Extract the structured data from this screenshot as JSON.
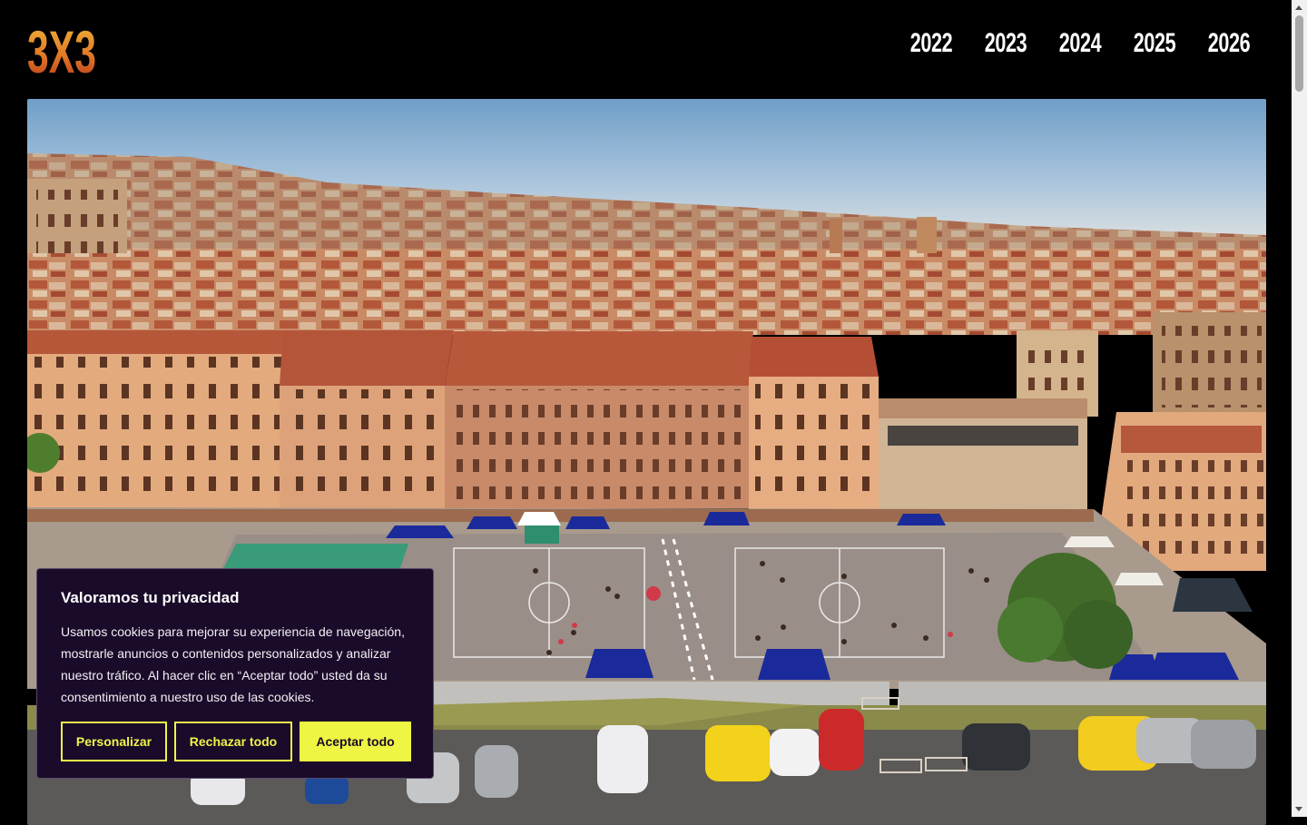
{
  "header": {
    "logo": {
      "text": "3X3",
      "icon": "3x3-logo"
    },
    "years": [
      "2022",
      "2023",
      "2024",
      "2025",
      "2026"
    ]
  },
  "hero": {
    "icon": "aerial-town-basketball-photo"
  },
  "cookie_banner": {
    "title": "Valoramos tu privacidad",
    "text": "Usamos cookies para mejorar su experiencia de navegación, mostrarle anuncios o contenidos personalizados y analizar nuestro tráfico. Al hacer clic en “Aceptar todo” usted da su consentimiento a nuestro uso de las cookies.",
    "customize_label": "Personalizar",
    "reject_label": "Rechazar todo",
    "accept_label": "Aceptar todo"
  },
  "colors": {
    "background": "#000000",
    "logo_gradient_top": "#f0b23a",
    "logo_gradient_bottom": "#c2411c",
    "banner_bg": "#1a0b2a",
    "banner_accent": "#eef542"
  }
}
